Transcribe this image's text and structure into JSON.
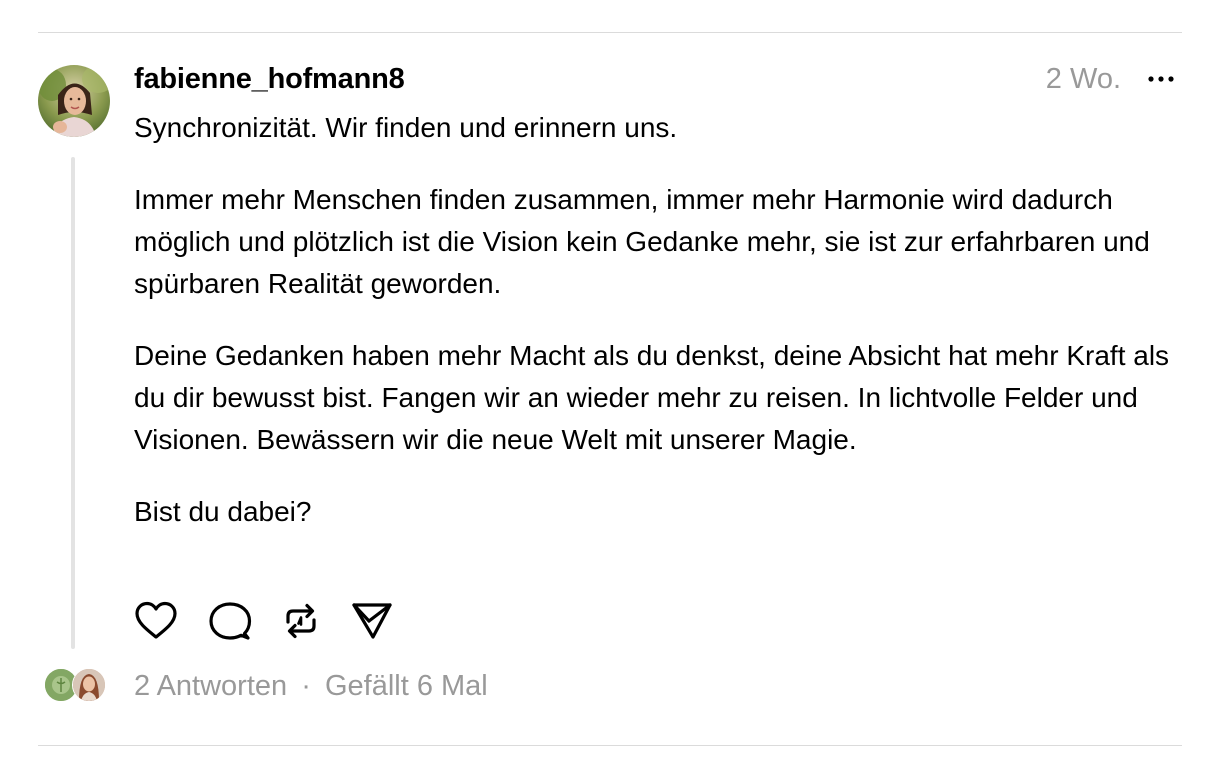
{
  "post": {
    "username": "fabienne_hofmann8",
    "time": "2 Wo.",
    "paragraphs": [
      "Synchronizität. Wir finden und erinnern uns.",
      "Immer mehr Menschen finden zusammen, immer mehr Harmonie wird dadurch möglich und plötzlich ist die Vision kein Gedanke mehr, sie ist zur erfahrbaren und spürbaren Realität geworden.",
      "Deine Gedanken haben mehr Macht als du denkst, deine Absicht hat mehr Kraft als du dir bewusst bist. Fangen wir an wieder mehr zu reisen. In lichtvolle Felder und Visionen. Bewässern wir die neue Welt mit unserer Magie.",
      "Bist du dabei?"
    ]
  },
  "actions": {
    "like": "heart-icon",
    "reply": "comment-icon",
    "repost": "repost-icon",
    "share": "send-icon",
    "more": "more-icon"
  },
  "footer": {
    "replies": "2 Antworten",
    "separator": "·",
    "likes": "Gefällt 6 Mal"
  }
}
